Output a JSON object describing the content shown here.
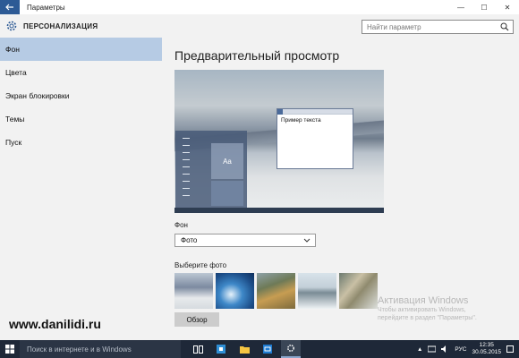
{
  "window": {
    "title": "Параметры",
    "controls": {
      "minimize": "—",
      "maximize": "☐",
      "close": "✕"
    }
  },
  "header": {
    "title": "ПЕРСОНАЛИЗАЦИЯ",
    "search_placeholder": "Найти параметр"
  },
  "sidebar": {
    "items": [
      {
        "label": "Фон",
        "selected": true
      },
      {
        "label": "Цвета"
      },
      {
        "label": "Экран блокировки"
      },
      {
        "label": "Темы"
      },
      {
        "label": "Пуск"
      }
    ]
  },
  "main": {
    "preview_heading": "Предварительный просмотр",
    "preview_tile_text": "Aa",
    "preview_window_text": "Пример текста",
    "background_label": "Фон",
    "background_value": "Фото",
    "choose_photo_label": "Выберите фото",
    "browse_button": "Обзор"
  },
  "activation": {
    "title": "Активация Windows",
    "line1": "Чтобы активировать Windows,",
    "line2": "перейдите в раздел \"Параметры\"."
  },
  "watermark": "www.danilidi.ru",
  "taskbar": {
    "search_placeholder": "Поиск в интернете и в Windows",
    "language": "РУС",
    "time": "12:35",
    "date": "30.05.2015"
  },
  "colors": {
    "accent": "#2d5a95",
    "selected_item": "#b6cbe4",
    "taskbar": "#1e2838"
  }
}
